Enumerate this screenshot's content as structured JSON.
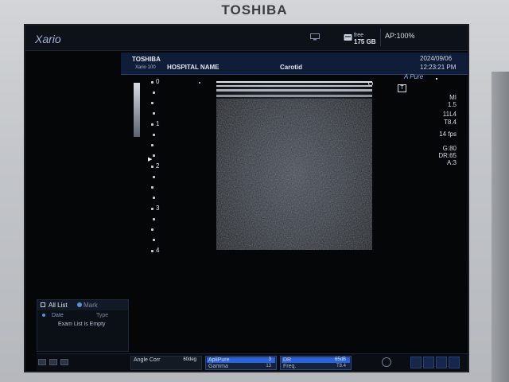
{
  "device": {
    "brand": "TOSHIBA"
  },
  "topbar": {
    "logo": "Xario",
    "monitor_icon": "monitor-icon",
    "disk_icon": "disk-icon",
    "free_label": "free",
    "free_value": "175 GB",
    "ap_value": "AP:100%"
  },
  "infobar": {
    "manufacturer": "TOSHIBA",
    "model": "Xario 100",
    "hospital": "HOSPITAL NAME",
    "exam_type": "Carotid",
    "date": "2024/09/06",
    "time": "12:23:21 PM"
  },
  "depth_scale": {
    "labels": [
      "0",
      "1",
      "2",
      "3",
      "4"
    ]
  },
  "side_panel": {
    "apure": "A Pure",
    "probe_icon": "probe-icon",
    "params": [
      "MI",
      "1.5",
      "11L4",
      "T8.4",
      "14 fps",
      "G:80",
      "DR:65",
      "A:3"
    ]
  },
  "exam_panel": {
    "all_list": "All List",
    "mark": "Mark",
    "date_col": "Date",
    "type_col": "Type",
    "empty_msg": "Exam List is Empty"
  },
  "bottombar": {
    "angle_corr_label": "Angle Corr",
    "angle_corr_value": "60deg",
    "applipure_label": "ApliPure",
    "applipure_value": "3",
    "gamma_label": "Gamma",
    "gamma_value": "13",
    "dr_label": "DR",
    "dr_value": "65dB",
    "freq_label": "Freq.",
    "freq_value": "T8.4"
  }
}
